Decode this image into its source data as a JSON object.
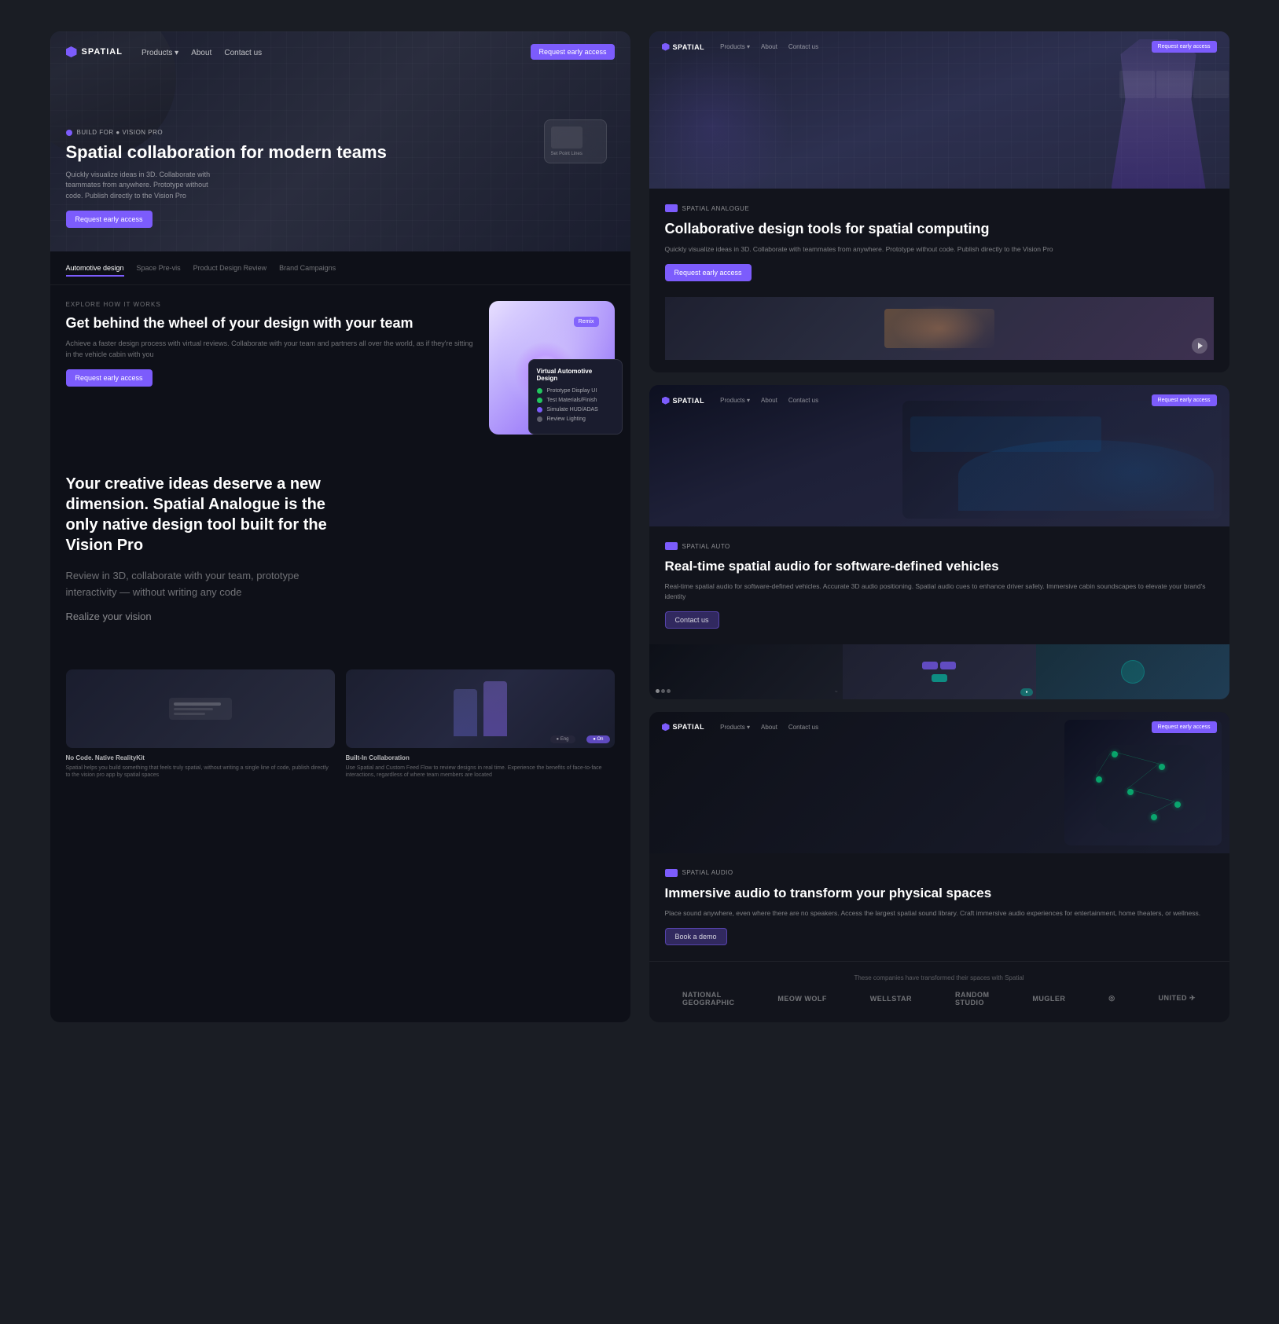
{
  "app": {
    "background": "#1a1d24"
  },
  "card_main": {
    "nav": {
      "logo": "SPATIAL",
      "links": [
        "Products ▾",
        "About",
        "Contact us"
      ],
      "cta": "Request early access"
    },
    "badge": "BUILD FOR ● VISION PRO",
    "hero_title": "Spatial collaboration for modern teams",
    "hero_desc": "Quickly visualize ideas in 3D. Collaborate with teammates from anywhere. Prototype without code. Publish directly to the Vision Pro",
    "hero_cta": "Request early access",
    "tabs": [
      "Automotive design",
      "Space Pre-vis",
      "Product Design Review",
      "Brand Campaigns"
    ],
    "active_tab": 0,
    "section_label": "EXPLORE HOW IT WORKS",
    "section_title": "Get behind the wheel of your design with your team",
    "section_desc": "Achieve a faster design process with virtual reviews. Collaborate with your team and partners all over the world, as if they're sitting in the vehicle cabin with you",
    "section_cta": "Request early access",
    "virtual_design": {
      "title": "Virtual Automotive Design",
      "items": [
        {
          "dot": "green",
          "text": "Prototype Display UI"
        },
        {
          "dot": "green",
          "text": "Test Materials/Finish"
        },
        {
          "dot": "purple",
          "text": "Simulate HUD/ADAS"
        },
        {
          "dot": "gray",
          "text": "Review Lighting"
        }
      ]
    },
    "creative_title": "Your creative ideas deserve a new dimension. Spatial Analogue is the only native design tool built for the  Vision Pro",
    "creative_subtitle": "Review in 3D, collaborate with your team, prototype interactivity — without writing any code",
    "realize_vision": "Realize your vision",
    "screenshots": [
      {
        "label": "No Code. Native RealityKit",
        "desc": "Spatial helps you build something that feels truly spatial, without writing a single line of code, publish directly to the vision pro app by spatial spaces"
      },
      {
        "label": "Built-In Collaboration",
        "desc": "Use Spatial and Custom Feed Flow to review designs in real time. Experience the benefits of face-to-face interactions, regardless of where team members are located"
      }
    ]
  },
  "card_collab": {
    "nav": {
      "logo": "SPATIAL",
      "links": [
        "Products ▾",
        "About",
        "Contact us"
      ],
      "cta": "Request early access"
    },
    "badge": "SPATIAL ANALOGUE",
    "title": "Collaborative design tools for spatial computing",
    "desc": "Quickly visualize ideas in 3D. Collaborate with teammates from anywhere. Prototype without code. Publish directly to the Vision Pro",
    "cta": "Request early access"
  },
  "card_spatial": {
    "nav": {
      "logo": "SPATIAL",
      "links": [
        "Products ▾",
        "About",
        "Contact us"
      ],
      "cta": "Request early access"
    },
    "badge": "SPATIAL AUTO",
    "title": "Real-time spatial audio for software-defined vehicles",
    "desc": "Real-time spatial audio for software-defined vehicles. Accurate 3D audio positioning. Spatial audio cues to enhance driver safety. Immersive cabin soundscapes to elevate your brand's identity",
    "cta": "Contact us"
  },
  "card_audio": {
    "nav": {
      "logo": "SPATIAL",
      "links": [
        "Products ▾",
        "About",
        "Contact us"
      ],
      "cta": "Request early access"
    },
    "badge": "SPATIAL AUDIO",
    "title": "Immersive audio to transform your physical spaces",
    "desc": "Place sound anywhere, even where there are no speakers. Access the largest spatial sound library. Craft immersive audio experiences for entertainment, home theaters, or wellness.",
    "cta": "Book a demo",
    "logos_title": "These companies have transformed their spaces with Spatial",
    "logos": [
      "National Geographic",
      "Meow Wolf",
      "Wellstar",
      "Random Studio",
      "MUGLER",
      "◎",
      "UNITED"
    ]
  }
}
